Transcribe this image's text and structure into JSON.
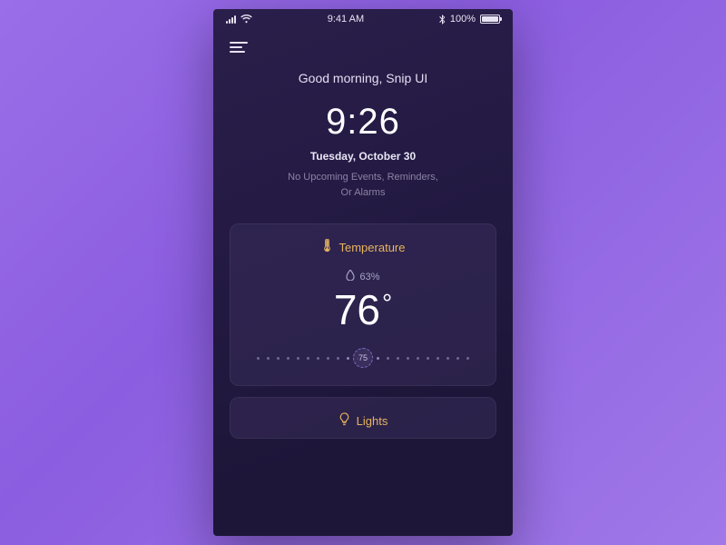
{
  "status": {
    "time": "9:41 AM",
    "battery_pct": "100%",
    "carrier_signal": 4,
    "wifi": true,
    "bluetooth": true
  },
  "header": {
    "greeting": "Good morning, Snip UI",
    "clock": "9:26",
    "date": "Tuesday, October 30",
    "events_line1": "No Upcoming Events, Reminders,",
    "events_line2": "Or Alarms"
  },
  "temperature_card": {
    "title": "Temperature",
    "humidity": "63%",
    "value": "76",
    "degree": "°",
    "slider_value": "75"
  },
  "lights_card": {
    "title": "Lights"
  },
  "colors": {
    "accent": "#e7b45f",
    "bg_start": "#2a1f4a",
    "bg_end": "#1d1638"
  }
}
